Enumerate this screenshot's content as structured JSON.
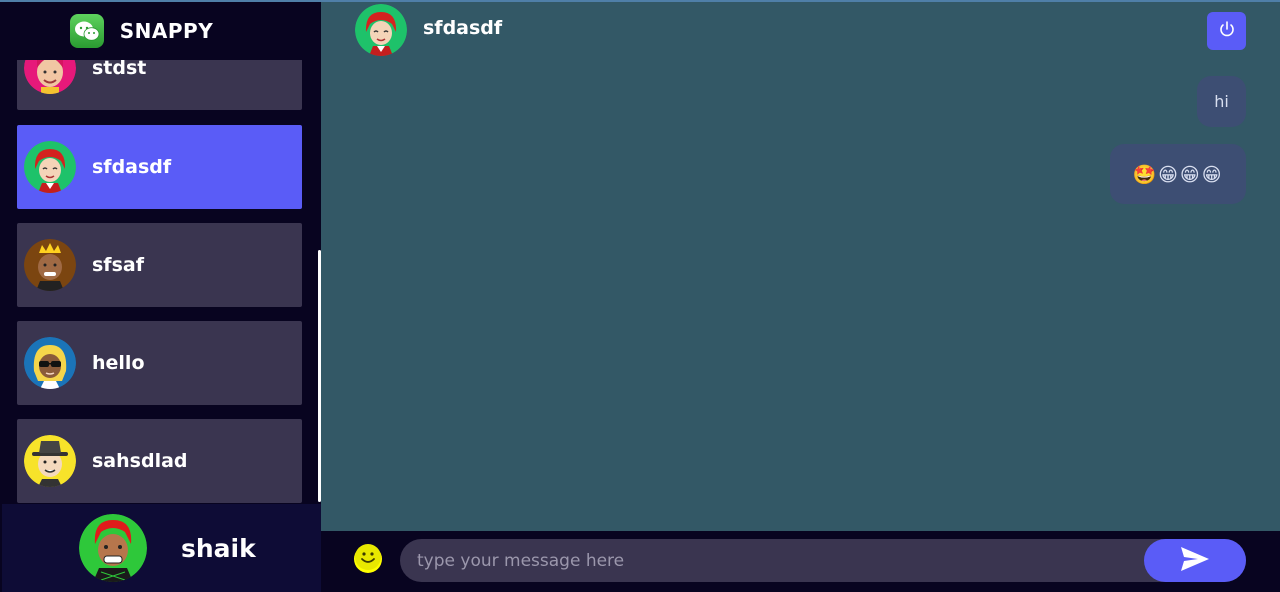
{
  "app": {
    "brand_name": "SNAPPY",
    "brand_icon": "wechat-logo-icon",
    "accent_color": "#5a5cf7"
  },
  "sidebar": {
    "contacts": [
      {
        "name": "stdst",
        "avatar": "pink-girl-avatar"
      },
      {
        "name": "sfdasdf",
        "avatar": "red-hair-avatar",
        "selected": true
      },
      {
        "name": "sfsaf",
        "avatar": "king-avatar"
      },
      {
        "name": "hello",
        "avatar": "sunglasses-blonde-avatar"
      },
      {
        "name": "sahsdlad",
        "avatar": "hat-man-avatar"
      }
    ],
    "current_user": {
      "name": "shaik",
      "avatar": "red-hair-smiling-avatar"
    }
  },
  "chat": {
    "contact_name": "sfdasdf",
    "logout_icon": "power-icon",
    "messages": [
      {
        "text": "hi",
        "sender": "me"
      },
      {
        "text": "🤩😁😁😁",
        "sender": "me"
      }
    ]
  },
  "composer": {
    "placeholder": "type your message here",
    "emoji_icon": "smiley-icon",
    "send_icon": "paper-plane-icon"
  }
}
